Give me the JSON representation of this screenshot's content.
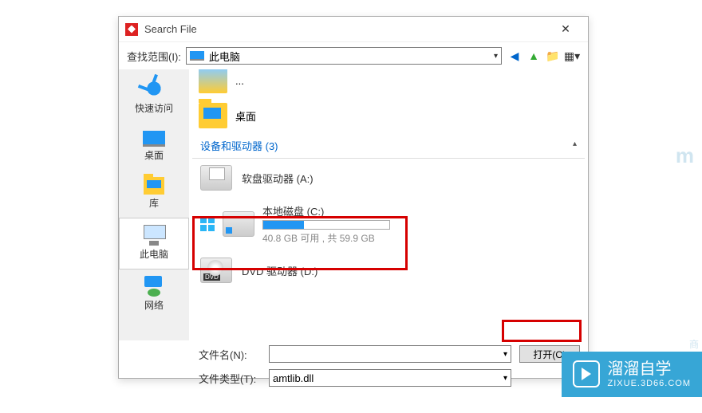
{
  "window": {
    "title": "Search File"
  },
  "lookin": {
    "label": "查找范围(I):",
    "value": "此电脑"
  },
  "sidebar": {
    "items": [
      {
        "label": "快速访问"
      },
      {
        "label": "桌面"
      },
      {
        "label": "库"
      },
      {
        "label": "此电脑"
      },
      {
        "label": "网络"
      }
    ]
  },
  "folders": [
    {
      "label": "..."
    },
    {
      "label": "桌面"
    }
  ],
  "devices": {
    "header": "设备和驱动器 (3)",
    "items": [
      {
        "name": "软盘驱动器 (A:)"
      },
      {
        "name": "本地磁盘 (C:)",
        "meta": "40.8 GB 可用 , 共 59.9 GB",
        "used_pct": 32
      },
      {
        "name": "DVD 驱动器 (D:)"
      }
    ]
  },
  "file": {
    "name_label": "文件名(N):",
    "name_value": "",
    "type_label": "文件类型(T):",
    "type_value": "amtlib.dll"
  },
  "buttons": {
    "open": "打开(O)"
  },
  "watermark": {
    "title": "溜溜自学",
    "sub": "ZIXUE.3D66.COM"
  },
  "faint": {
    "m": "m",
    "txt": "商"
  }
}
